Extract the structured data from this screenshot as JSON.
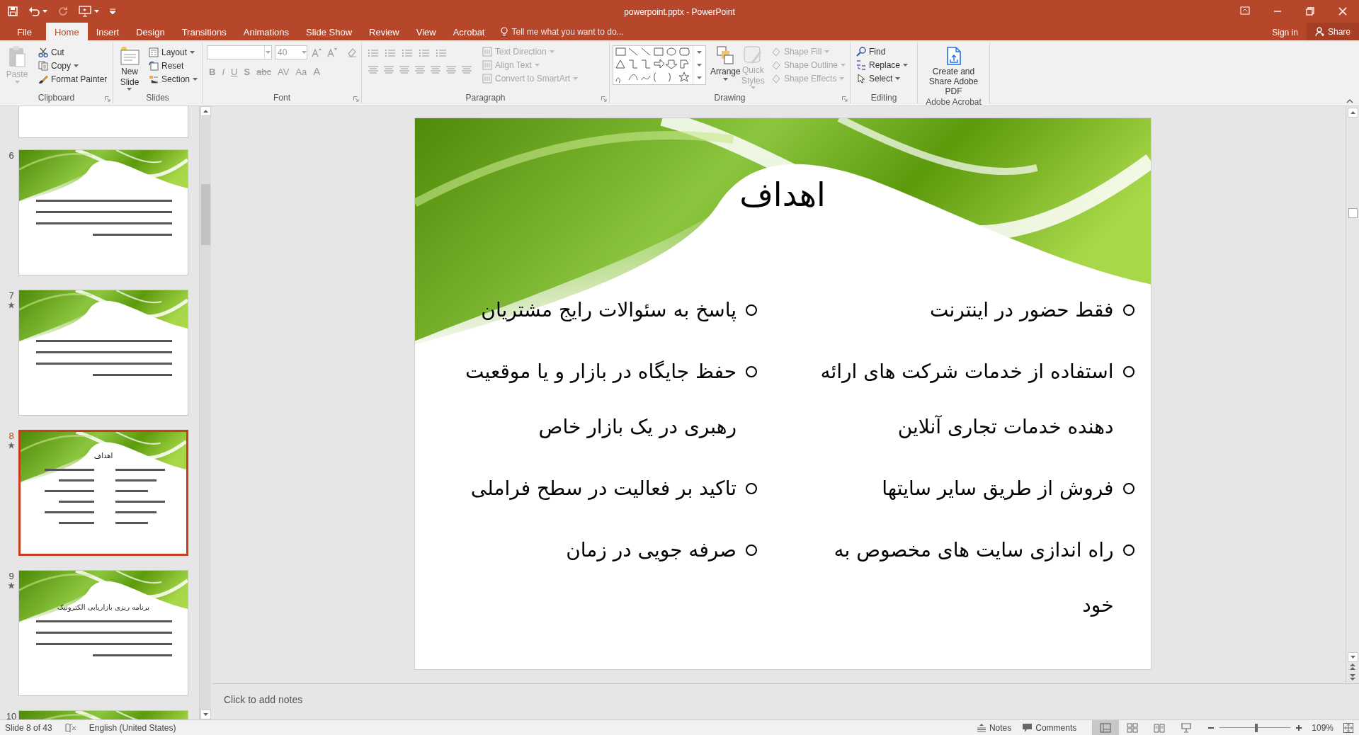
{
  "window": {
    "title": "powerpoint.pptx - PowerPoint"
  },
  "tabs": [
    {
      "label": "File",
      "selected": false
    },
    {
      "label": "Home",
      "selected": true
    },
    {
      "label": "Insert",
      "selected": false
    },
    {
      "label": "Design",
      "selected": false
    },
    {
      "label": "Transitions",
      "selected": false
    },
    {
      "label": "Animations",
      "selected": false
    },
    {
      "label": "Slide Show",
      "selected": false
    },
    {
      "label": "Review",
      "selected": false
    },
    {
      "label": "View",
      "selected": false
    },
    {
      "label": "Acrobat",
      "selected": false
    }
  ],
  "tell_me": {
    "placeholder": "Tell me what you want to do..."
  },
  "sign_in": "Sign in",
  "share": "Share",
  "clipboard": {
    "label": "Clipboard",
    "paste": {
      "label": "Paste",
      "disabled": true
    },
    "cut": "Cut",
    "copy": "Copy",
    "format_painter": "Format Painter"
  },
  "slides_group": {
    "label": "Slides",
    "new_slide": "New Slide",
    "layout": "Layout",
    "reset": "Reset",
    "section": "Section"
  },
  "font": {
    "label": "Font",
    "font_size": "40",
    "buttons": [
      "B",
      "I",
      "U",
      "S",
      "abc",
      "AV",
      "Aa",
      "A"
    ]
  },
  "paragraph": {
    "label": "Paragraph",
    "text_direction": {
      "label": "Text Direction",
      "disabled": true
    },
    "align_text": {
      "label": "Align Text",
      "disabled": true
    },
    "convert": {
      "label": "Convert to SmartArt",
      "disabled": true
    }
  },
  "drawing": {
    "label": "Drawing",
    "arrange": "Arrange",
    "quick_styles": {
      "label": "Quick Styles",
      "disabled": true
    },
    "shape_fill": {
      "label": "Shape Fill",
      "disabled": true
    },
    "shape_outline": {
      "label": "Shape Outline",
      "disabled": true
    },
    "shape_effects": {
      "label": "Shape Effects",
      "disabled": true
    }
  },
  "editing": {
    "label": "Editing",
    "find": "Find",
    "replace": "Replace",
    "select": "Select"
  },
  "acrobat": {
    "label": "Adobe Acrobat",
    "create": "Create and Share Adobe PDF"
  },
  "thumbnails": [
    {
      "number": "6",
      "animated": false,
      "selected": false
    },
    {
      "number": "7",
      "animated": true,
      "selected": false
    },
    {
      "number": "8",
      "animated": true,
      "selected": true,
      "title": "اهداف"
    },
    {
      "number": "9",
      "animated": true,
      "selected": false,
      "title": "برنامه ریزی بازاریابی الکترونیک"
    },
    {
      "number": "10",
      "animated": false,
      "selected": false
    }
  ],
  "slide": {
    "title": "اهداف",
    "columns": [
      {
        "bullets": [
          "فقط حضور در اینترنت",
          "استفاده از خدمات شرکت های ارائه دهنده خدمات تجاری آنلاین",
          "فروش از طریق سایر سایتها",
          "راه اندازی سایت های مخصوص به خود"
        ]
      },
      {
        "bullets": [
          "پاسخ به سئوالات رایج مشتریان",
          "حفظ جایگاه در بازار و یا موقعیت رهبری در یک بازار خاص",
          "تاکید بر فعالیت در سطح فراملی",
          "صرفه جویی در زمان"
        ]
      }
    ]
  },
  "notes": {
    "placeholder": "Click to add notes"
  },
  "status_bar": {
    "slide": "Slide 8 of 43",
    "language": "English (United States)",
    "notes": "Notes",
    "comments": "Comments",
    "views": [
      {
        "selected": true
      },
      {
        "selected": false
      },
      {
        "selected": false
      },
      {
        "selected": false
      }
    ],
    "zoom": {
      "level": 0.52
    },
    "zoom_reading": "109%"
  }
}
